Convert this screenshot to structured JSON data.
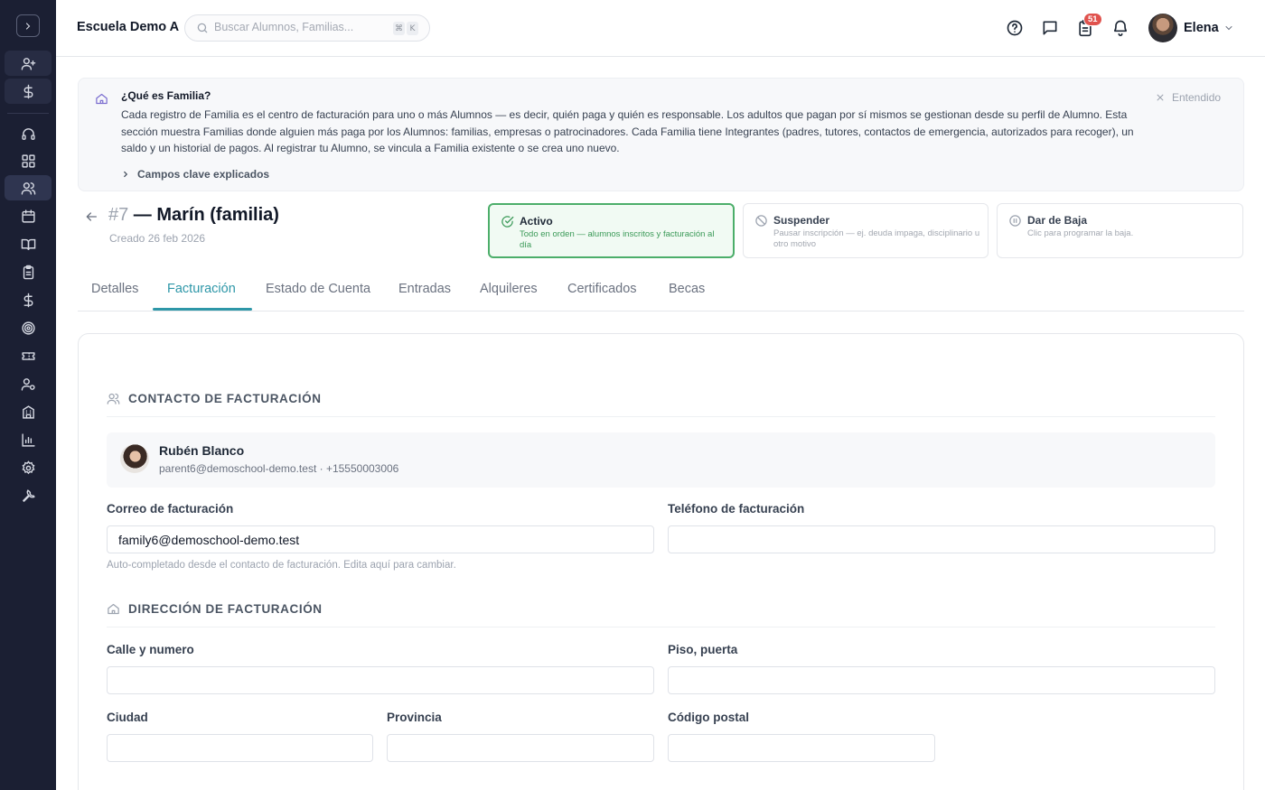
{
  "topbar": {
    "school": "Escuela Demo A",
    "search_placeholder": "Buscar Alumnos, Familias...",
    "kbd_1": "⌘",
    "kbd_2": "K",
    "notif_badge": "51",
    "user_name": "Elena"
  },
  "info": {
    "title": "¿Qué es Familia?",
    "body": "Cada registro de Familia es el centro de facturación para uno o más Alumnos — es decir, quién paga y quién es responsable. Los adultos que pagan por sí mismos se gestionan desde su perfil de Alumno. Esta sección muestra Familias donde alguien más paga por los Alumnos: familias, empresas o patrocinadores. Cada Familia tiene Integrantes (padres, tutores, contactos de emergencia, autorizados para recoger), un saldo y un historial de pagos. Al registrar tu Alumno, se vincula a Familia existente o se crea uno nuevo.",
    "dismiss": "Entendido",
    "expand": "Campos clave explicados"
  },
  "family": {
    "number": "#7",
    "name": " — Marín (familia)",
    "created": "Creado 26 feb 2026"
  },
  "status": [
    {
      "title": "Activo",
      "desc": "Todo en orden — alumnos inscritos y facturación al día"
    },
    {
      "title": "Suspender",
      "desc": "Pausar inscripción — ej. deuda impaga, disciplinario u otro motivo"
    },
    {
      "title": "Dar de Baja",
      "desc": "Clic para programar la baja."
    }
  ],
  "tabs": [
    "Detalles",
    "Facturación",
    "Estado de Cuenta",
    "Entradas",
    "Alquileres",
    "Certificados",
    "Becas"
  ],
  "billing": {
    "contact_heading": "CONTACTO DE FACTURACIÓN",
    "contact_name": "Rubén Blanco",
    "contact_sub": "parent6@demoschool-demo.test · +15550003006",
    "email_label": "Correo de facturación",
    "email_value": "family6@demoschool-demo.test",
    "phone_label": "Teléfono de facturación",
    "phone_value": "",
    "hint": "Auto-completado desde el contacto de facturación. Edita aquí para cambiar.",
    "address_heading": "DIRECCIÓN DE FACTURACIÓN",
    "street_label": "Calle y numero",
    "floor_label": "Piso, puerta",
    "city_label": "Ciudad",
    "province_label": "Provincia",
    "postal_label": "Código postal"
  }
}
